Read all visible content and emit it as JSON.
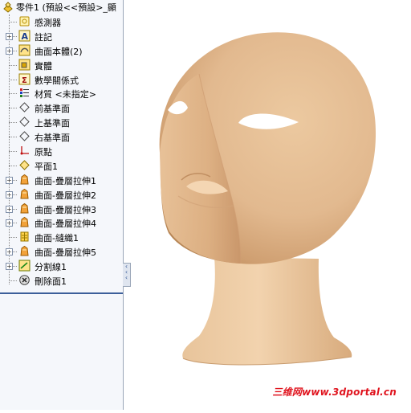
{
  "tree": {
    "root_label": "零件1 (預設<<預設>_顯",
    "items": [
      {
        "label": "感測器",
        "icon": "sensor-icon",
        "expandable": false
      },
      {
        "label": "註記",
        "icon": "annotation-icon",
        "expandable": true
      },
      {
        "label": "曲面本體(2)",
        "icon": "surface-bodies-icon",
        "expandable": true
      },
      {
        "label": "實體",
        "icon": "solid-bodies-icon",
        "expandable": false
      },
      {
        "label": "數學關係式",
        "icon": "equations-icon",
        "expandable": false
      },
      {
        "label": "材質 <未指定>",
        "icon": "material-icon",
        "expandable": false
      },
      {
        "label": "前基準面",
        "icon": "plane-icon",
        "expandable": false
      },
      {
        "label": "上基準面",
        "icon": "plane-icon",
        "expandable": false
      },
      {
        "label": "右基準面",
        "icon": "plane-icon",
        "expandable": false
      },
      {
        "label": "原點",
        "icon": "origin-icon",
        "expandable": false
      },
      {
        "label": "平面1",
        "icon": "plane1-icon",
        "expandable": false
      },
      {
        "label": "曲面-疊層拉伸1",
        "icon": "surface-loft-icon",
        "expandable": true
      },
      {
        "label": "曲面-疊層拉伸2",
        "icon": "surface-loft-icon",
        "expandable": true
      },
      {
        "label": "曲面-疊層拉伸3",
        "icon": "surface-loft-icon",
        "expandable": true
      },
      {
        "label": "曲面-疊層拉伸4",
        "icon": "surface-loft-icon",
        "expandable": true
      },
      {
        "label": "曲面-縫織1",
        "icon": "surface-knit-icon",
        "expandable": false
      },
      {
        "label": "曲面-疊層拉伸5",
        "icon": "surface-loft-icon",
        "expandable": true
      },
      {
        "label": "分割線1",
        "icon": "split-line-icon",
        "expandable": true
      },
      {
        "label": "刪除面1",
        "icon": "delete-face-icon",
        "expandable": false
      }
    ]
  },
  "viewport": {
    "model": "head-surface-model",
    "skin_color": "#e2b98f"
  },
  "watermark": "三维网www.3dportal.cn"
}
